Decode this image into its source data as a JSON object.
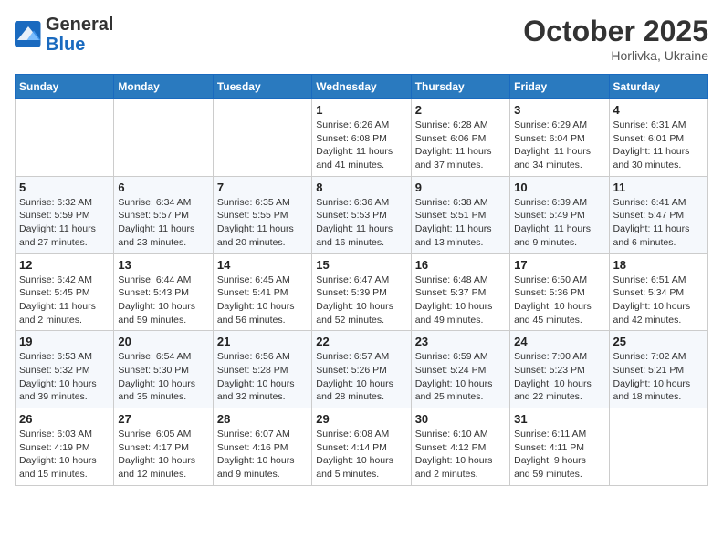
{
  "logo": {
    "general": "General",
    "blue": "Blue"
  },
  "header": {
    "month": "October 2025",
    "location": "Horlivka, Ukraine"
  },
  "weekdays": [
    "Sunday",
    "Monday",
    "Tuesday",
    "Wednesday",
    "Thursday",
    "Friday",
    "Saturday"
  ],
  "weeks": [
    [
      {
        "day": "",
        "info": ""
      },
      {
        "day": "",
        "info": ""
      },
      {
        "day": "",
        "info": ""
      },
      {
        "day": "1",
        "info": "Sunrise: 6:26 AM\nSunset: 6:08 PM\nDaylight: 11 hours\nand 41 minutes."
      },
      {
        "day": "2",
        "info": "Sunrise: 6:28 AM\nSunset: 6:06 PM\nDaylight: 11 hours\nand 37 minutes."
      },
      {
        "day": "3",
        "info": "Sunrise: 6:29 AM\nSunset: 6:04 PM\nDaylight: 11 hours\nand 34 minutes."
      },
      {
        "day": "4",
        "info": "Sunrise: 6:31 AM\nSunset: 6:01 PM\nDaylight: 11 hours\nand 30 minutes."
      }
    ],
    [
      {
        "day": "5",
        "info": "Sunrise: 6:32 AM\nSunset: 5:59 PM\nDaylight: 11 hours\nand 27 minutes."
      },
      {
        "day": "6",
        "info": "Sunrise: 6:34 AM\nSunset: 5:57 PM\nDaylight: 11 hours\nand 23 minutes."
      },
      {
        "day": "7",
        "info": "Sunrise: 6:35 AM\nSunset: 5:55 PM\nDaylight: 11 hours\nand 20 minutes."
      },
      {
        "day": "8",
        "info": "Sunrise: 6:36 AM\nSunset: 5:53 PM\nDaylight: 11 hours\nand 16 minutes."
      },
      {
        "day": "9",
        "info": "Sunrise: 6:38 AM\nSunset: 5:51 PM\nDaylight: 11 hours\nand 13 minutes."
      },
      {
        "day": "10",
        "info": "Sunrise: 6:39 AM\nSunset: 5:49 PM\nDaylight: 11 hours\nand 9 minutes."
      },
      {
        "day": "11",
        "info": "Sunrise: 6:41 AM\nSunset: 5:47 PM\nDaylight: 11 hours\nand 6 minutes."
      }
    ],
    [
      {
        "day": "12",
        "info": "Sunrise: 6:42 AM\nSunset: 5:45 PM\nDaylight: 11 hours\nand 2 minutes."
      },
      {
        "day": "13",
        "info": "Sunrise: 6:44 AM\nSunset: 5:43 PM\nDaylight: 10 hours\nand 59 minutes."
      },
      {
        "day": "14",
        "info": "Sunrise: 6:45 AM\nSunset: 5:41 PM\nDaylight: 10 hours\nand 56 minutes."
      },
      {
        "day": "15",
        "info": "Sunrise: 6:47 AM\nSunset: 5:39 PM\nDaylight: 10 hours\nand 52 minutes."
      },
      {
        "day": "16",
        "info": "Sunrise: 6:48 AM\nSunset: 5:37 PM\nDaylight: 10 hours\nand 49 minutes."
      },
      {
        "day": "17",
        "info": "Sunrise: 6:50 AM\nSunset: 5:36 PM\nDaylight: 10 hours\nand 45 minutes."
      },
      {
        "day": "18",
        "info": "Sunrise: 6:51 AM\nSunset: 5:34 PM\nDaylight: 10 hours\nand 42 minutes."
      }
    ],
    [
      {
        "day": "19",
        "info": "Sunrise: 6:53 AM\nSunset: 5:32 PM\nDaylight: 10 hours\nand 39 minutes."
      },
      {
        "day": "20",
        "info": "Sunrise: 6:54 AM\nSunset: 5:30 PM\nDaylight: 10 hours\nand 35 minutes."
      },
      {
        "day": "21",
        "info": "Sunrise: 6:56 AM\nSunset: 5:28 PM\nDaylight: 10 hours\nand 32 minutes."
      },
      {
        "day": "22",
        "info": "Sunrise: 6:57 AM\nSunset: 5:26 PM\nDaylight: 10 hours\nand 28 minutes."
      },
      {
        "day": "23",
        "info": "Sunrise: 6:59 AM\nSunset: 5:24 PM\nDaylight: 10 hours\nand 25 minutes."
      },
      {
        "day": "24",
        "info": "Sunrise: 7:00 AM\nSunset: 5:23 PM\nDaylight: 10 hours\nand 22 minutes."
      },
      {
        "day": "25",
        "info": "Sunrise: 7:02 AM\nSunset: 5:21 PM\nDaylight: 10 hours\nand 18 minutes."
      }
    ],
    [
      {
        "day": "26",
        "info": "Sunrise: 6:03 AM\nSunset: 4:19 PM\nDaylight: 10 hours\nand 15 minutes."
      },
      {
        "day": "27",
        "info": "Sunrise: 6:05 AM\nSunset: 4:17 PM\nDaylight: 10 hours\nand 12 minutes."
      },
      {
        "day": "28",
        "info": "Sunrise: 6:07 AM\nSunset: 4:16 PM\nDaylight: 10 hours\nand 9 minutes."
      },
      {
        "day": "29",
        "info": "Sunrise: 6:08 AM\nSunset: 4:14 PM\nDaylight: 10 hours\nand 5 minutes."
      },
      {
        "day": "30",
        "info": "Sunrise: 6:10 AM\nSunset: 4:12 PM\nDaylight: 10 hours\nand 2 minutes."
      },
      {
        "day": "31",
        "info": "Sunrise: 6:11 AM\nSunset: 4:11 PM\nDaylight: 9 hours\nand 59 minutes."
      },
      {
        "day": "",
        "info": ""
      }
    ]
  ]
}
